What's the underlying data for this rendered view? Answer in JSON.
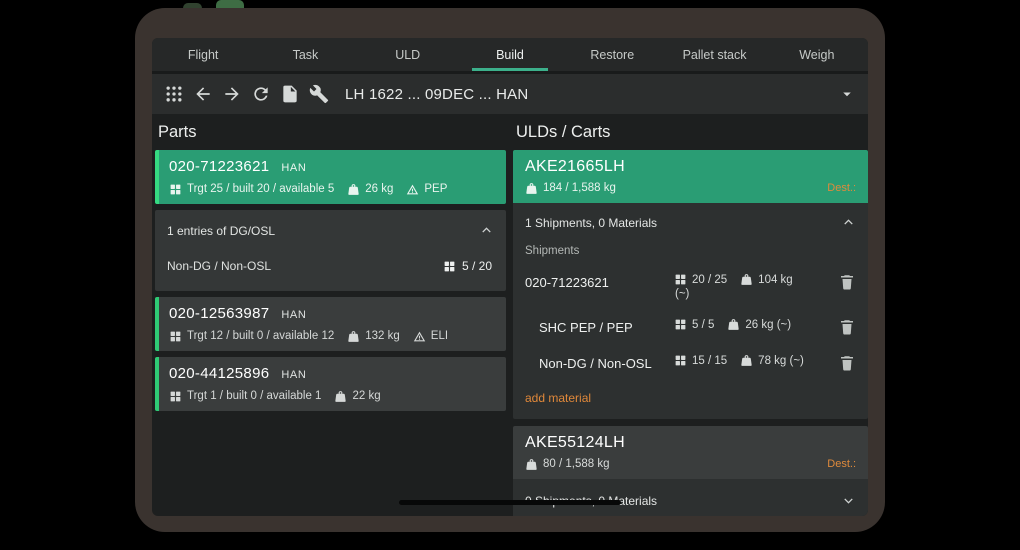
{
  "tabs": {
    "flight": "Flight",
    "task": "Task",
    "uld": "ULD",
    "build": "Build",
    "restore": "Restore",
    "pallet_stack": "Pallet stack",
    "weigh": "Weigh",
    "active": "Build"
  },
  "toolbar": {
    "title": "LH 1622 ... 09DEC ... HAN"
  },
  "parts": {
    "header": "Parts",
    "card1": {
      "id": "020-71223621",
      "dest": "HAN",
      "stats": "Trgt 25 / built 20 / available 5",
      "weight": "26 kg",
      "shc": "PEP"
    },
    "dg_panel": {
      "title": "1 entries of DG/OSL",
      "row": {
        "label": "Non-DG / Non-OSL",
        "count": "5 / 20"
      }
    },
    "card2": {
      "id": "020-12563987",
      "dest": "HAN",
      "stats": "Trgt 12 / built 0 / available 12",
      "weight": "132 kg",
      "shc": "ELI"
    },
    "card3": {
      "id": "020-44125896",
      "dest": "HAN",
      "stats": "Trgt 1 / built 0 / available 1",
      "weight": "22 kg"
    }
  },
  "ulds": {
    "header": "ULDs / Carts",
    "card1": {
      "id": "AKE21665LH",
      "weight": "184 / 1,588 kg",
      "dest_label": "Dest.:",
      "summary": "1 Shipments, 0 Materials",
      "shipments_label": "Shipments",
      "row1": {
        "label": "020-71223621",
        "count": "20 / 25",
        "weight": "104 kg",
        "weight_note": "(~)"
      },
      "row2": {
        "label": "SHC PEP / PEP",
        "count": "5 / 5",
        "weight": "26 kg (~)"
      },
      "row3": {
        "label": "Non-DG / Non-OSL",
        "count": "15 / 15",
        "weight": "78 kg (~)"
      },
      "add_material": "add material"
    },
    "card2": {
      "id": "AKE55124LH",
      "weight": "80 / 1,588 kg",
      "dest_label": "Dest.:",
      "summary": "0 Shipments, 0 Materials"
    }
  },
  "colors": {
    "accent_green": "#2a9d74",
    "highlight_green": "#35da81",
    "accent_orange": "#e0883a",
    "tab_underline": "#3cb08b"
  }
}
